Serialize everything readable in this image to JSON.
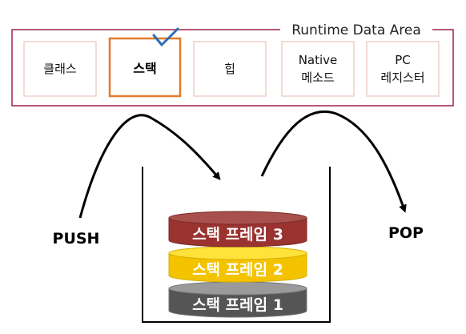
{
  "runtime_area": {
    "title": "Runtime Data Area",
    "boxes": [
      {
        "lines": [
          "클래스"
        ],
        "highlighted": false
      },
      {
        "lines": [
          "스택"
        ],
        "highlighted": true
      },
      {
        "lines": [
          "힙"
        ],
        "highlighted": false
      },
      {
        "lines": [
          "Native",
          "메소드"
        ],
        "highlighted": false
      },
      {
        "lines": [
          "PC",
          "레지스터"
        ],
        "highlighted": false
      }
    ]
  },
  "stack": {
    "push_label": "PUSH",
    "pop_label": "POP",
    "frames": [
      {
        "label": "스택 프레임 3",
        "color": "#9a3330",
        "top_color": "#a8514c"
      },
      {
        "label": "스택 프레임 2",
        "color": "#f3c300",
        "top_color": "#ffe23a"
      },
      {
        "label": "스택 프레임 1",
        "color": "#555555",
        "top_color": "#9a9a9a"
      }
    ]
  },
  "colors": {
    "area_border": "#a3214f",
    "box_border": "#f0cfc9",
    "highlight_border": "#e07b2c",
    "checkmark": "#2e6fb5",
    "arrow": "#000000"
  }
}
